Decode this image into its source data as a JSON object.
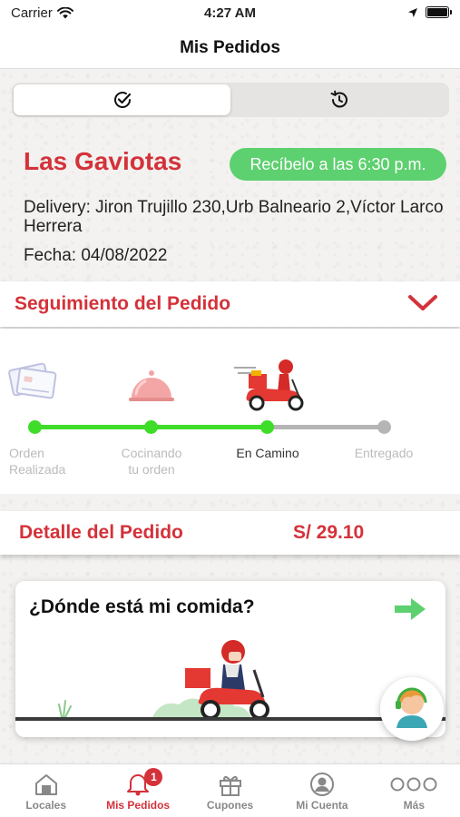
{
  "status_bar": {
    "carrier": "Carrier",
    "time": "4:27 AM"
  },
  "nav": {
    "title": "Mis Pedidos"
  },
  "segments": [
    {
      "icon": "check-circle-icon",
      "active": true
    },
    {
      "icon": "history-icon",
      "active": false
    }
  ],
  "order": {
    "store_name": "Las Gaviotas",
    "eta": "Recíbelo a las 6:30 p.m.",
    "address": "Delivery: Jiron Trujillo 230,Urb Balneario 2,Víctor Larco Herrera",
    "date": "Fecha: 04/08/2022"
  },
  "tracking": {
    "title": "Seguimiento del Pedido",
    "steps": [
      {
        "label": "Orden\nRealizada",
        "done": true,
        "icon": "credit-card-icon"
      },
      {
        "label": "Cocinando\ntu orden",
        "done": true,
        "icon": "food-cloche-icon"
      },
      {
        "label": "En Camino",
        "done": true,
        "current": true,
        "icon": "delivery-scooter-icon"
      },
      {
        "label": "Entregado",
        "done": false
      }
    ]
  },
  "detail": {
    "title": "Detalle del Pedido",
    "total": "S/ 29.10"
  },
  "where_card": {
    "title": "¿Dónde está mi comida?"
  },
  "tabs": [
    {
      "label": "Locales",
      "icon": "store-icon"
    },
    {
      "label": "Mis Pedidos",
      "icon": "bell-icon",
      "badge": "1",
      "active": true
    },
    {
      "label": "Cupones",
      "icon": "gift-icon"
    },
    {
      "label": "Mi Cuenta",
      "icon": "user-icon"
    },
    {
      "label": "Más",
      "icon": "more-icon"
    }
  ],
  "colors": {
    "brand_red": "#d4323a",
    "success_green": "#3fdc2a",
    "eta_green": "#5dd06f",
    "pending_gray": "#b5b5b5"
  }
}
